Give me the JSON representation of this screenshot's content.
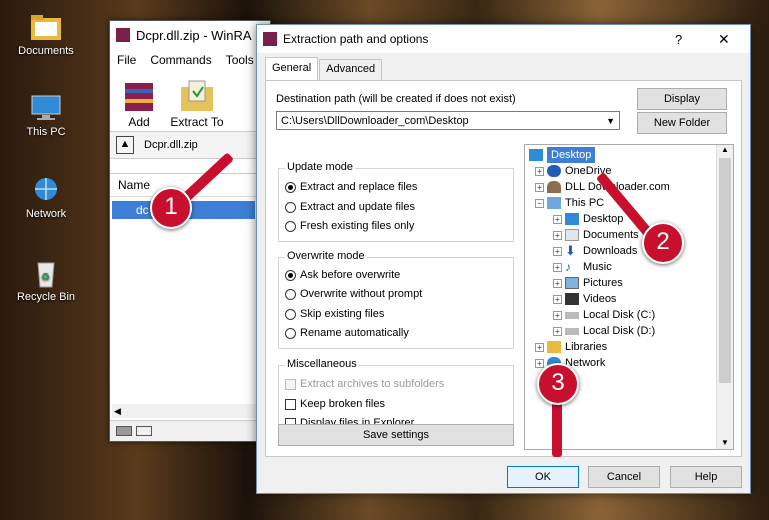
{
  "desktop": {
    "icons": [
      {
        "label": "Documents",
        "icon": "folder-icon"
      },
      {
        "label": "This PC",
        "icon": "computer-icon"
      },
      {
        "label": "Network",
        "icon": "network-icon"
      },
      {
        "label": "Recycle Bin",
        "icon": "recycle-bin-icon"
      }
    ]
  },
  "winrar": {
    "title": "Dcpr.dll.zip - WinRA",
    "menu": [
      "File",
      "Commands",
      "Tools"
    ],
    "toolbar": [
      {
        "label": "Add"
      },
      {
        "label": "Extract To"
      }
    ],
    "address": "Dcpr.dll.zip",
    "column_name": "Name",
    "row": "dc"
  },
  "dialog": {
    "title": "Extraction path and options",
    "help": "?",
    "close": "✕",
    "tabs": [
      "General",
      "Advanced"
    ],
    "dest_label": "Destination path (will be created if does not exist)",
    "dest_value": "C:\\Users\\DllDownloader_com\\Desktop",
    "display_btn": "Display",
    "new_folder_btn": "New Folder",
    "update_mode": {
      "label": "Update mode",
      "options": [
        "Extract and replace files",
        "Extract and update files",
        "Fresh existing files only"
      ],
      "selected": 0
    },
    "overwrite_mode": {
      "label": "Overwrite mode",
      "options": [
        "Ask before overwrite",
        "Overwrite without prompt",
        "Skip existing files",
        "Rename automatically"
      ],
      "selected": 0
    },
    "misc": {
      "label": "Miscellaneous",
      "options": [
        "Extract archives to subfolders",
        "Keep broken files",
        "Display files in Explorer"
      ]
    },
    "save_btn": "Save settings",
    "ok_btn": "OK",
    "cancel_btn": "Cancel",
    "help_btn": "Help",
    "tree": [
      {
        "label": "Desktop",
        "selected": true
      },
      {
        "label": "OneDrive"
      },
      {
        "label": "DLL Downloader.com"
      },
      {
        "label": "This PC"
      },
      {
        "label": "Desktop"
      },
      {
        "label": "Documents"
      },
      {
        "label": "Downloads"
      },
      {
        "label": "Music"
      },
      {
        "label": "Pictures"
      },
      {
        "label": "Videos"
      },
      {
        "label": "Local Disk (C:)"
      },
      {
        "label": "Local Disk (D:)"
      },
      {
        "label": "Libraries"
      },
      {
        "label": "Network"
      }
    ]
  },
  "steps": [
    "1",
    "2",
    "3"
  ],
  "colors": {
    "accent": "#0078d7",
    "step_badge": "#c8102e",
    "selection": "#3d7fd6"
  }
}
